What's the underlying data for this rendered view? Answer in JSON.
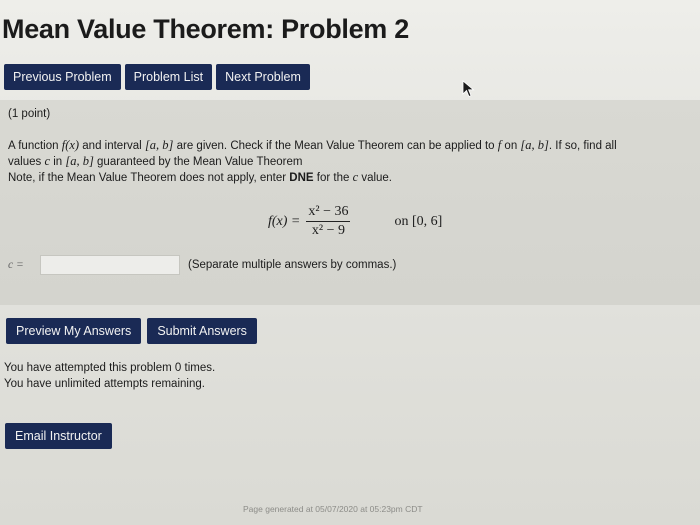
{
  "page": {
    "title": "Mean Value Theorem: Problem 2"
  },
  "nav": {
    "previous": "Previous Problem",
    "list": "Problem List",
    "next": "Next Problem"
  },
  "problem": {
    "points": "(1 point)",
    "line1_a": "A function ",
    "line1_fx": "f(x)",
    "line1_b": " and interval ",
    "line1_ab": "[a, b]",
    "line1_c": " are given. Check if the Mean Value Theorem can be applied to ",
    "line1_f": "f",
    "line1_d": " on ",
    "line1_ab2": "[a, b]",
    "line1_e": ". If so, find all",
    "line2_a": "values ",
    "line2_c": "c",
    "line2_b": " in ",
    "line2_ab": "[a, b]",
    "line2_d": " guaranteed by the Mean Value Theorem",
    "line3_a": "Note, if the Mean Value Theorem does not apply, enter ",
    "line3_dne": "DNE",
    "line3_b": " for the ",
    "line3_c": "c",
    "line3_d": " value.",
    "formula_lhs": "f(x) =",
    "formula_num": "x² − 36",
    "formula_den": "x² − 9",
    "formula_interval": "on [0, 6]"
  },
  "answer": {
    "label": "c =",
    "value": "",
    "hint": "(Separate multiple answers by commas.)"
  },
  "actions": {
    "preview": "Preview My Answers",
    "submit": "Submit Answers"
  },
  "attempts": {
    "line1": "You have attempted this problem 0 times.",
    "line2": "You have unlimited attempts remaining."
  },
  "email": {
    "label": "Email Instructor"
  },
  "footer": {
    "text": "Page generated at 05/07/2020 at 05:23pm CDT"
  },
  "colors": {
    "button_bg": "#1a2a55",
    "button_text": "#f2f2f2"
  }
}
